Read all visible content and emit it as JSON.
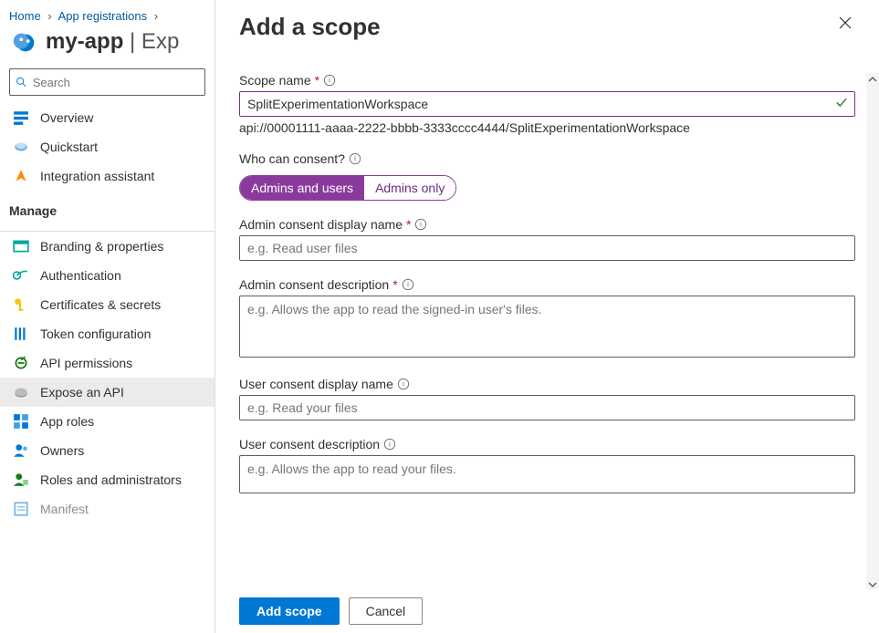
{
  "breadcrumb": {
    "home": "Home",
    "appreg": "App registrations"
  },
  "header": {
    "app_name": "my-app",
    "page_suffix": " | Exp"
  },
  "search": {
    "placeholder": "Search"
  },
  "nav": {
    "top": [
      {
        "label": "Overview"
      },
      {
        "label": "Quickstart"
      },
      {
        "label": "Integration assistant"
      }
    ],
    "manage_label": "Manage",
    "manage": [
      {
        "label": "Branding & properties"
      },
      {
        "label": "Authentication"
      },
      {
        "label": "Certificates & secrets"
      },
      {
        "label": "Token configuration"
      },
      {
        "label": "API permissions"
      },
      {
        "label": "Expose an API",
        "selected": true
      },
      {
        "label": "App roles"
      },
      {
        "label": "Owners"
      },
      {
        "label": "Roles and administrators"
      },
      {
        "label": "Manifest"
      }
    ]
  },
  "panel": {
    "title": "Add a scope",
    "scope_name_label": "Scope name",
    "scope_name_value": "SplitExperimentationWorkspace",
    "scope_hint": "api://00001111-aaaa-2222-bbbb-3333cccc4444/SplitExperimentationWorkspace",
    "consent_label": "Who can consent?",
    "consent_opts": {
      "a": "Admins and users",
      "b": "Admins only"
    },
    "admin_display_label": "Admin consent display name",
    "admin_display_ph": "e.g. Read user files",
    "admin_desc_label": "Admin consent description",
    "admin_desc_ph": "e.g. Allows the app to read the signed-in user's files.",
    "user_display_label": "User consent display name",
    "user_display_ph": "e.g. Read your files",
    "user_desc_label": "User consent description",
    "user_desc_ph": "e.g. Allows the app to read your files.",
    "add_btn": "Add scope",
    "cancel_btn": "Cancel"
  }
}
